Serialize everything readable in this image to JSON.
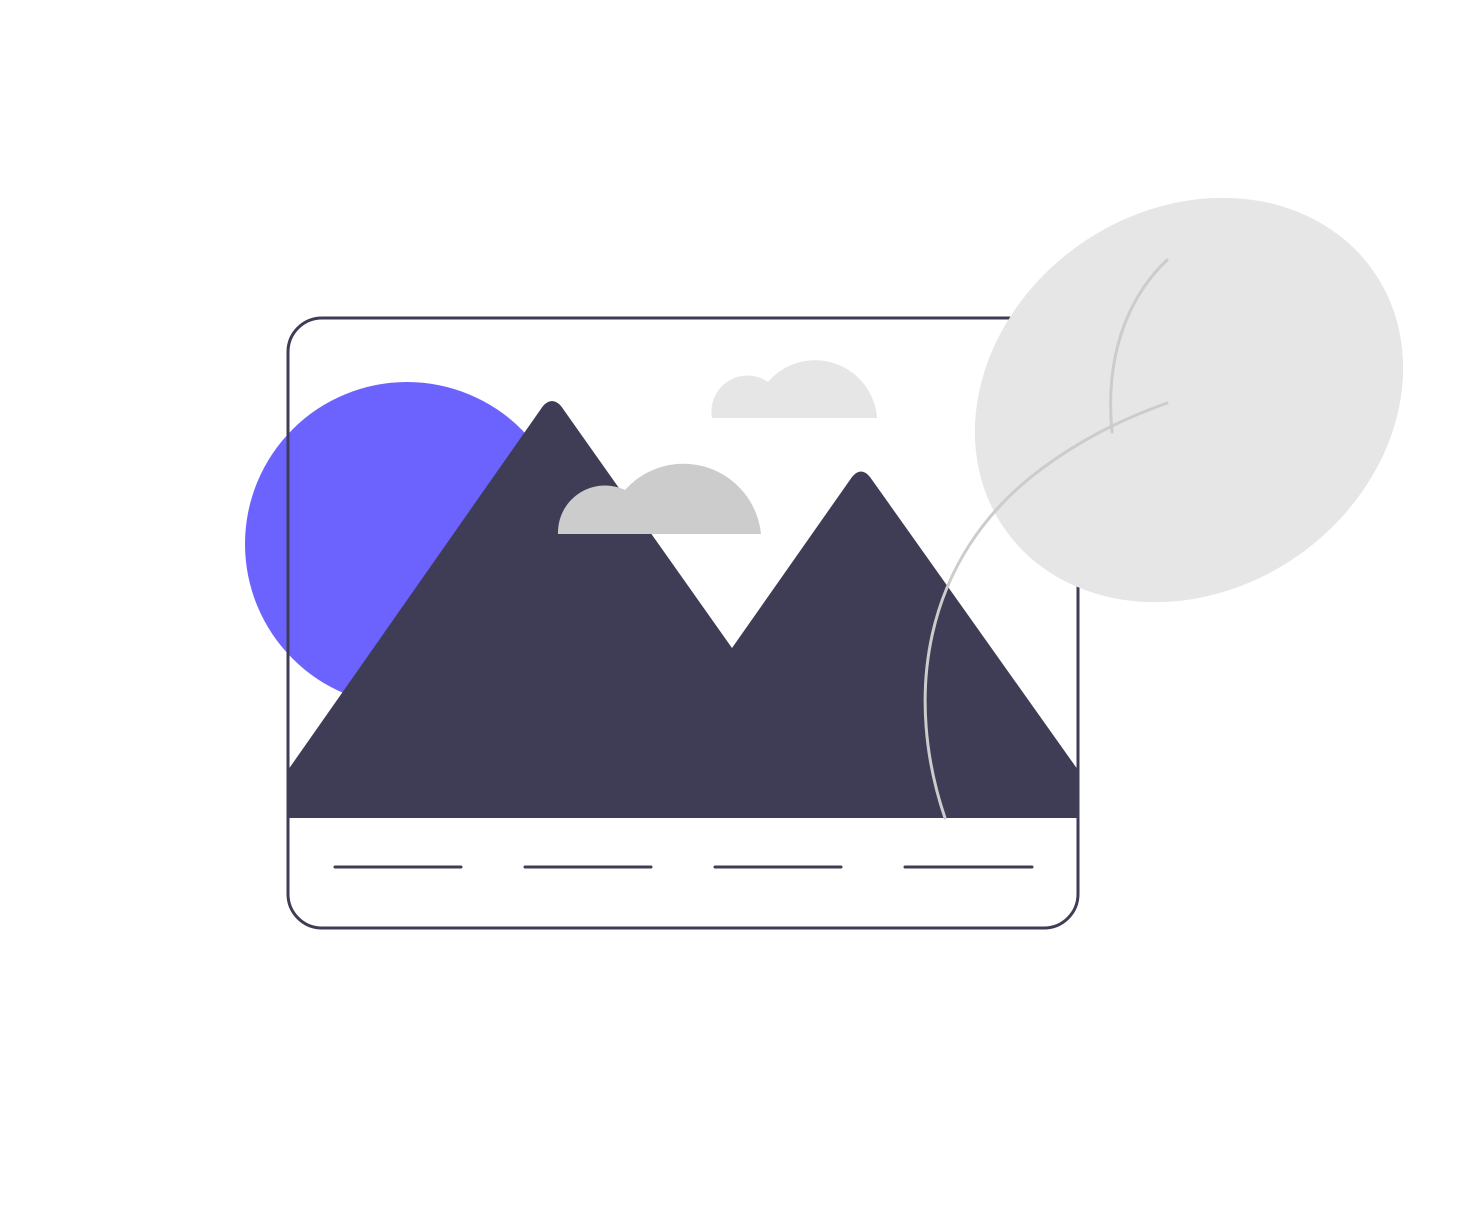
{
  "illustration": {
    "subject": "image-placeholder",
    "colors": {
      "background": "#ffffff",
      "frame_stroke": "#3f3d56",
      "mountain": "#3f3d56",
      "sun": "#6c63ff",
      "cloud_back": "#e6e6e6",
      "cloud_front": "#cccccc",
      "leaf": "#e6e6e6",
      "leaf_vein": "#cccccc",
      "caption_line": "#3f3d56"
    },
    "caption_line_count": 4
  }
}
